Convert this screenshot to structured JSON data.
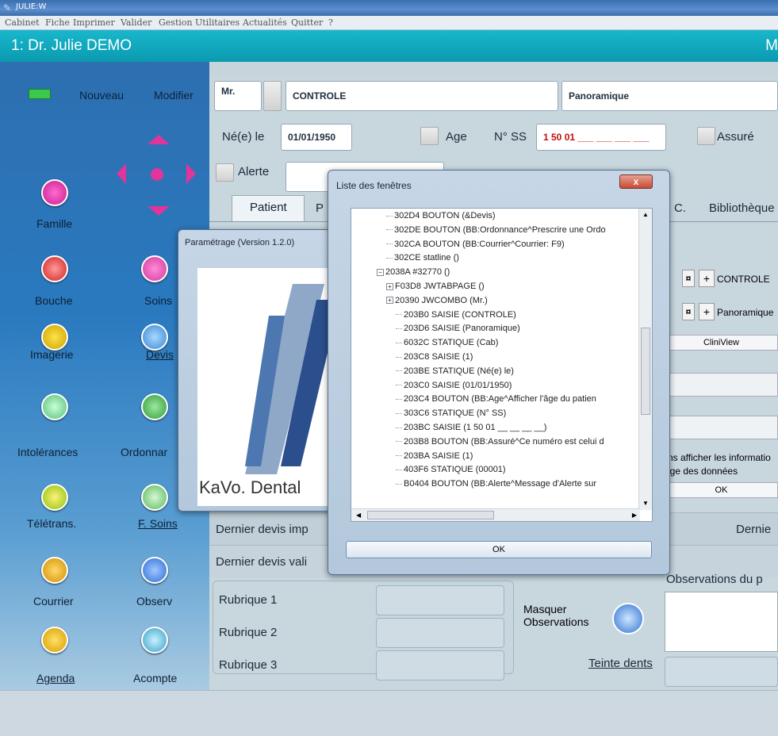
{
  "window": {
    "title": "JULIE:W"
  },
  "menu": [
    "Cabinet",
    "Fiche",
    "Imprimer",
    "Valider",
    "Gestion",
    "Utilitaires",
    "Actualités",
    "Quitter",
    "?"
  ],
  "header": {
    "doctor": "1: Dr. Julie DEMO",
    "right_letter": "M"
  },
  "sidebar": {
    "nouveau": "Nouveau",
    "modifier": "Modifier",
    "items": [
      "Famille",
      "Bouche",
      "Soins",
      "Imagerie",
      "Devis",
      "Intolérances",
      "Ordonnar",
      "Télétrans.",
      "F. Soins",
      "Courrier",
      "Observ",
      "Agenda",
      "Acompte"
    ]
  },
  "patient": {
    "civility": "Mr.",
    "name": "CONTROLE",
    "firstname": "Panoramique",
    "born_label": "Né(e) le",
    "birthdate": "01/01/1950",
    "age_label": "Age",
    "ss_label": "N° SS",
    "ss_value": "1 50 01 ___ ___ ___ ___",
    "assure_label": "Assuré",
    "alerte_label": "Alerte"
  },
  "tabs": {
    "patient": "Patient",
    "p": "P",
    "c": "C.",
    "biblio": "Bibliothèque"
  },
  "right_panel": {
    "controle": "CONTROLE",
    "panoramique": "Panoramique",
    "cliniview": "CliniView",
    "info1": "ns afficher les informatio",
    "info2": "age des données",
    "ok": "OK",
    "dernie": "Dernie"
  },
  "devis": {
    "imprime": "Dernier devis imp",
    "valide": "Dernier devis vali"
  },
  "rubriques": [
    "Rubrique 1",
    "Rubrique 2",
    "Rubrique 3"
  ],
  "observations": {
    "masquer": "Masquer Observations",
    "title": "Observations du p",
    "teinte": "Teinte dents"
  },
  "param_window": {
    "title": "Paramétrage (Version 1.2.0)",
    "logo": "KaVo. Dental"
  },
  "list_window": {
    "title": "Liste des fenêtres",
    "close": "x",
    "ok": "OK",
    "rows": [
      {
        "text": "302D4 BOUTON (&Devis)",
        "indent": 1,
        "exp": ""
      },
      {
        "text": "302DE BOUTON (BB:Ordonnance^Prescrire une Ordo",
        "indent": 1,
        "exp": ""
      },
      {
        "text": "302CA BOUTON (BB:Courrier^Courrier: F9)",
        "indent": 1,
        "exp": ""
      },
      {
        "text": "302CE statline ()",
        "indent": 1,
        "exp": ""
      },
      {
        "text": "2038A #32770 ()",
        "indent": 1,
        "exp": "−"
      },
      {
        "text": "F03D8 JWTABPAGE ()",
        "indent": 2,
        "exp": "+"
      },
      {
        "text": "20390 JWCOMBO (Mr.)",
        "indent": 2,
        "exp": "+"
      },
      {
        "text": "203B0 SAISIE (CONTROLE)",
        "indent": 2,
        "exp": ""
      },
      {
        "text": "203D6 SAISIE (Panoramique)",
        "indent": 2,
        "exp": ""
      },
      {
        "text": "6032C STATIQUE (Cab)",
        "indent": 2,
        "exp": ""
      },
      {
        "text": "203C8 SAISIE (1)",
        "indent": 2,
        "exp": ""
      },
      {
        "text": "203BE STATIQUE (Né(e) le)",
        "indent": 2,
        "exp": ""
      },
      {
        "text": "203C0 SAISIE (01/01/1950)",
        "indent": 2,
        "exp": ""
      },
      {
        "text": "203C4 BOUTON (BB:Age^Afficher l'âge du patien",
        "indent": 2,
        "exp": ""
      },
      {
        "text": "303C6 STATIQUE (N° SS)",
        "indent": 2,
        "exp": ""
      },
      {
        "text": "203BC SAISIE (1 50 01 __ __ __ __)",
        "indent": 2,
        "exp": ""
      },
      {
        "text": "203B8 BOUTON (BB:Assuré^Ce numéro est celui d",
        "indent": 2,
        "exp": ""
      },
      {
        "text": "203BA SAISIE (1)",
        "indent": 2,
        "exp": ""
      },
      {
        "text": "403F6 STATIQUE (00001)",
        "indent": 2,
        "exp": ""
      },
      {
        "text": "B0404 BOUTON (BB:Alerte^Message d'Alerte sur",
        "indent": 2,
        "exp": ""
      }
    ]
  }
}
